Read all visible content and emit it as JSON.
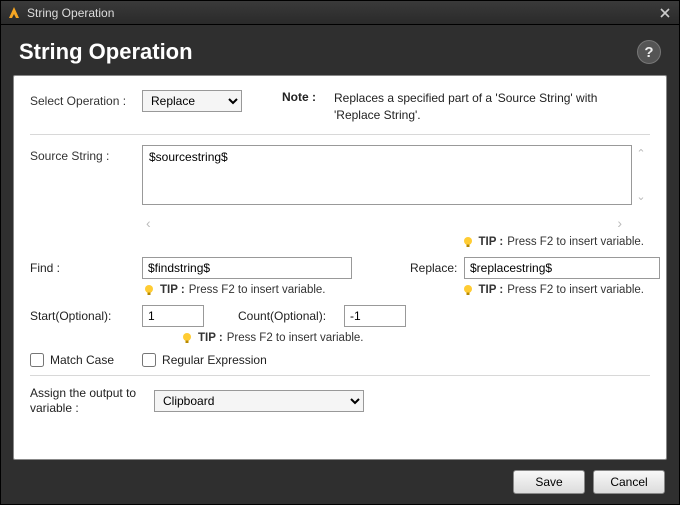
{
  "titlebar": {
    "title": "String Operation"
  },
  "header": {
    "title": "String Operation"
  },
  "operation": {
    "label": "Select Operation :",
    "selected": "Replace",
    "note_label": "Note :",
    "note_text": "Replaces a specified part of a 'Source String' with 'Replace String'."
  },
  "source": {
    "label": "Source String :",
    "value": "$sourcestring$"
  },
  "tip": {
    "label": "TIP :",
    "text": "Press F2 to insert variable."
  },
  "find": {
    "label": "Find :",
    "value": "$findstring$"
  },
  "replace": {
    "label": "Replace:",
    "value": "$replacestring$"
  },
  "start": {
    "label": "Start(Optional):",
    "value": "1"
  },
  "count": {
    "label": "Count(Optional):",
    "value": "-1"
  },
  "checks": {
    "match_case": "Match Case",
    "regex": "Regular Expression",
    "match_case_checked": false,
    "regex_checked": false
  },
  "assign": {
    "label": "Assign the output to variable :",
    "selected": "Clipboard"
  },
  "footer": {
    "save": "Save",
    "cancel": "Cancel"
  }
}
